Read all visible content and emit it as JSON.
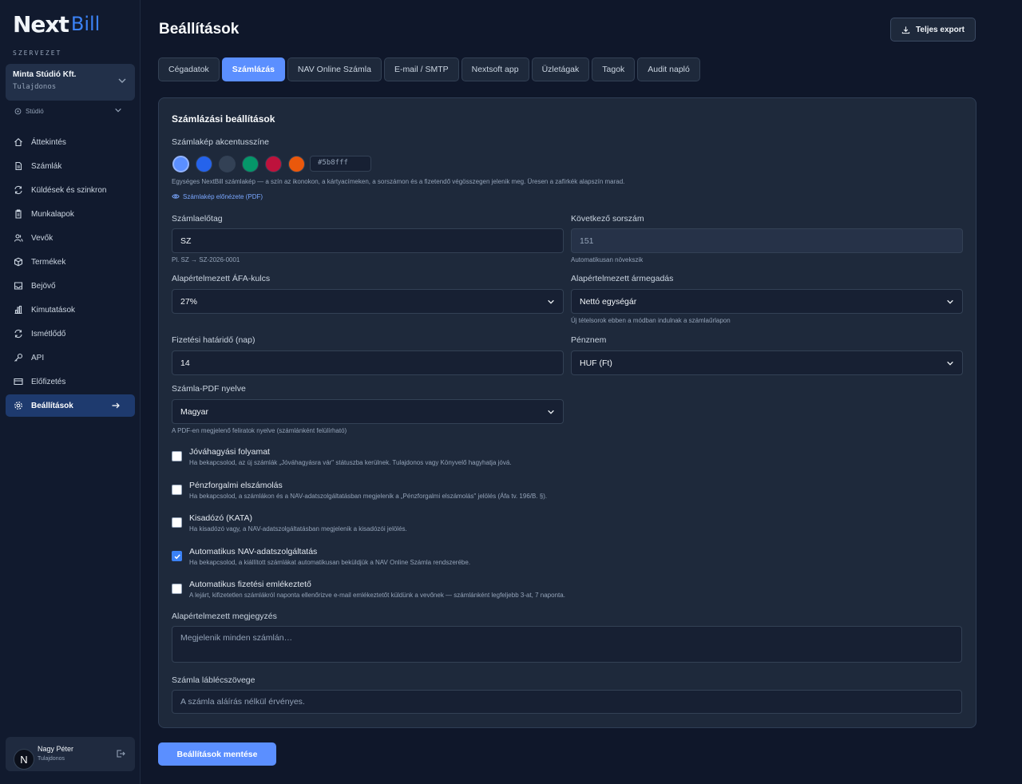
{
  "app": {
    "logo_next": "Next",
    "logo_bill": "Bill"
  },
  "sidebar": {
    "org_label": "SZERVEZET",
    "org_name": "Minta Stúdió Kft.",
    "org_role": "Tulajdonos",
    "studio": "Stúdió",
    "items": [
      {
        "label": "Áttekintés",
        "icon": "home-icon"
      },
      {
        "label": "Számlák",
        "icon": "document-icon"
      },
      {
        "label": "Küldések és szinkron",
        "icon": "sync-icon"
      },
      {
        "label": "Munkalapok",
        "icon": "clipboard-icon"
      },
      {
        "label": "Vevők",
        "icon": "users-icon"
      },
      {
        "label": "Termékek",
        "icon": "box-icon"
      },
      {
        "label": "Bejövő",
        "icon": "inbox-icon"
      },
      {
        "label": "Kimutatások",
        "icon": "chart-icon"
      },
      {
        "label": "Ismétlődő",
        "icon": "repeat-icon"
      },
      {
        "label": "API",
        "icon": "key-icon"
      },
      {
        "label": "Előfizetés",
        "icon": "card-icon"
      },
      {
        "label": "Beállítások",
        "icon": "gear-icon",
        "active": true
      }
    ],
    "user_initial": "N",
    "user_name": "Nagy Péter",
    "user_role": "Tulajdonos"
  },
  "header": {
    "title": "Beállítások",
    "export_label": "Teljes export"
  },
  "tabs": [
    {
      "label": "Cégadatok"
    },
    {
      "label": "Számlázás",
      "active": true
    },
    {
      "label": "NAV Online Számla"
    },
    {
      "label": "E-mail / SMTP"
    },
    {
      "label": "Nextsoft app"
    },
    {
      "label": "Üzletágak"
    },
    {
      "label": "Tagok"
    },
    {
      "label": "Audit napló"
    }
  ],
  "billing": {
    "title": "Számlázási beállítások",
    "accent_label": "Számlakép akcentusszíne",
    "accent_colors": [
      "#5b8fff",
      "#2563eb",
      "#334155",
      "#059669",
      "#be123c",
      "#ea580c"
    ],
    "accent_value": "#5b8fff",
    "accent_hint": "Egységes NextBill számlakép — a szín az ikonokon, a kártyacímeken, a sorszámon és a fizetendő végösszegen jelenik meg. Üresen a zafírkék alapszín marad.",
    "preview_link": "Számlakép előnézete (PDF)",
    "prefix_label": "Számlaelőtag",
    "prefix_value": "SZ",
    "prefix_hint": "Pl. SZ → SZ-2026-0001",
    "next_no_label": "Következő sorszám",
    "next_no_value": "151",
    "next_no_hint": "Automatikusan növekszik",
    "vat_label": "Alapértelmezett ÁFA-kulcs",
    "vat_value": "27%",
    "price_label": "Alapértelmezett ármegadás",
    "price_value": "Nettó egységár",
    "price_hint": "Új tételsorok ebben a módban indulnak a számlaűrlapon",
    "due_label": "Fizetési határidő (nap)",
    "due_value": "14",
    "currency_label": "Pénznem",
    "currency_value": "HUF (Ft)",
    "lang_label": "Számla-PDF nyelve",
    "lang_value": "Magyar",
    "lang_hint": "A PDF-en megjelenő feliratok nyelve (számlánként felülírható)",
    "checkboxes": [
      {
        "title": "Jóváhagyási folyamat",
        "desc": "Ha bekapcsolod, az új számlák „Jóváhagyásra vár\" státuszba kerülnek. Tulajdonos vagy Könyvelő hagyhatja jóvá.",
        "checked": false
      },
      {
        "title": "Pénzforgalmi elszámolás",
        "desc": "Ha bekapcsolod, a számlákon és a NAV-adatszolgáltatásban megjelenik a „Pénzforgalmi elszámolás\" jelölés (Áfa tv. 196/B. §).",
        "checked": false
      },
      {
        "title": "Kisadózó (KATA)",
        "desc": "Ha kisadózó vagy, a NAV-adatszolgáltatásban megjelenik a kisadózói jelölés.",
        "checked": false
      },
      {
        "title": "Automatikus NAV-adatszolgáltatás",
        "desc": "Ha bekapcsolod, a kiállított számlákat automatikusan beküldjük a NAV Online Számla rendszerébe.",
        "checked": true
      },
      {
        "title": "Automatikus fizetési emlékeztető",
        "desc": "A lejárt, kifizetetlen számlákról naponta ellenőrizve e-mail emlékeztetőt küldünk a vevőnek — számlánként legfeljebb 3-at, 7 naponta.",
        "checked": false
      }
    ],
    "note_label": "Alapértelmezett megjegyzés",
    "note_placeholder": "Megjelenik minden számlán…",
    "footer_label": "Számla láblécszövege",
    "footer_placeholder": "A számla aláírás nélkül érvényes."
  },
  "save_label": "Beállítások mentése"
}
